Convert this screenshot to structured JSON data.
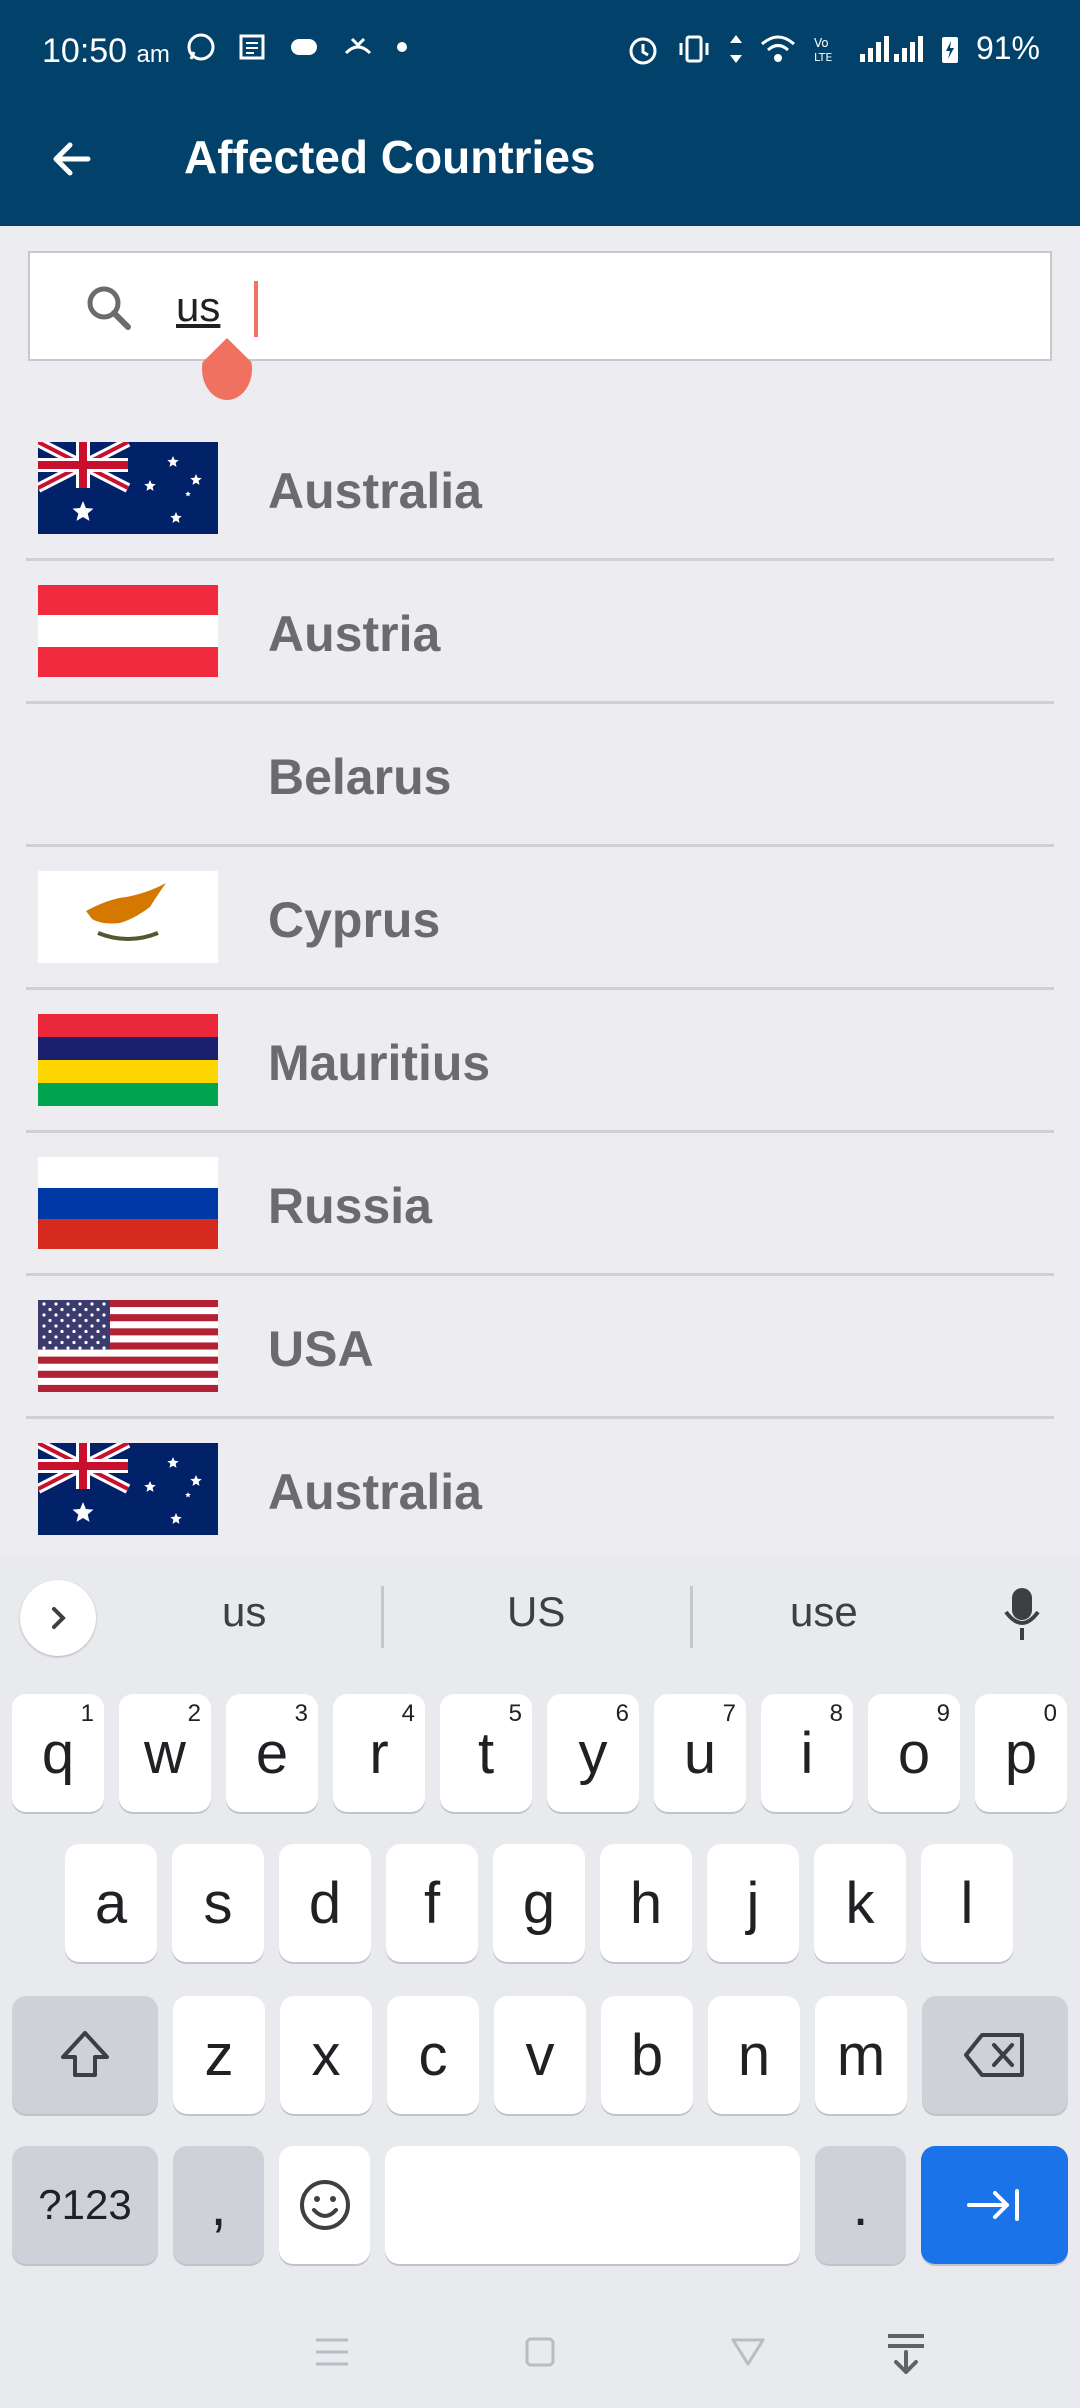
{
  "status": {
    "time": "10:50",
    "ampm": "am",
    "battery": "91%"
  },
  "app_bar": {
    "title": "Affected Countries"
  },
  "search": {
    "value": "us"
  },
  "countries": [
    {
      "name": "Australia",
      "flag": "australia"
    },
    {
      "name": "Austria",
      "flag": "austria"
    },
    {
      "name": "Belarus",
      "flag": "none"
    },
    {
      "name": "Cyprus",
      "flag": "cyprus"
    },
    {
      "name": "Mauritius",
      "flag": "mauritius"
    },
    {
      "name": "Russia",
      "flag": "russia"
    },
    {
      "name": "USA",
      "flag": "usa"
    },
    {
      "name": "Australia",
      "flag": "australia"
    }
  ],
  "keyboard": {
    "suggestions": [
      "us",
      "US",
      "use"
    ],
    "row1": [
      "q",
      "w",
      "e",
      "r",
      "t",
      "y",
      "u",
      "i",
      "o",
      "p"
    ],
    "row1_nums": [
      "1",
      "2",
      "3",
      "4",
      "5",
      "6",
      "7",
      "8",
      "9",
      "0"
    ],
    "row2": [
      "a",
      "s",
      "d",
      "f",
      "g",
      "h",
      "j",
      "k",
      "l"
    ],
    "row3": [
      "z",
      "x",
      "c",
      "v",
      "b",
      "n",
      "m"
    ],
    "symbols_label": "?123",
    "comma": ",",
    "period": "."
  },
  "colors": {
    "app_bar": "#02426a",
    "caret": "#f17161",
    "action_key": "#1a73e8"
  }
}
